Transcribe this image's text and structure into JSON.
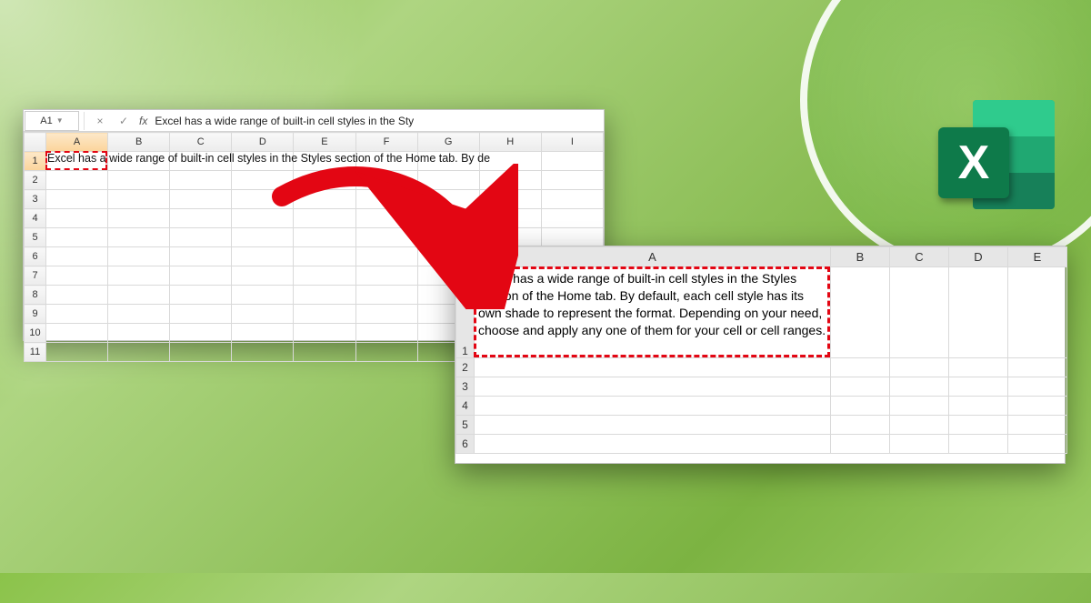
{
  "nameBox": {
    "ref": "A1"
  },
  "formulaBar": {
    "cancelIcon": "×",
    "enterIcon": "✓",
    "fxLabel": "fx",
    "text": "Excel has a wide range of built-in cell styles in the Sty"
  },
  "panel1": {
    "columnHeaders": [
      "A",
      "B",
      "C",
      "D",
      "E",
      "F",
      "G",
      "H",
      "I"
    ],
    "rowHeaders": [
      "1",
      "2",
      "3",
      "4",
      "5",
      "6",
      "7",
      "8",
      "9",
      "10",
      "11"
    ],
    "a1OverflowText": "Excel has a wide range of built-in cell styles in the Styles section of the Home tab. By de"
  },
  "panel2": {
    "columnHeaders": [
      "A",
      "B",
      "C",
      "D",
      "E"
    ],
    "rowHeaders": [
      "1",
      "2",
      "3",
      "4",
      "5",
      "6"
    ],
    "a1Text": "Excel has a wide range of built-in cell styles in the Styles section of the Home tab. By default, each cell style has its own shade to represent the format. Depending on your need, choose and apply any one of them for your cell or cell ranges."
  },
  "logo": {
    "letter": "X"
  }
}
